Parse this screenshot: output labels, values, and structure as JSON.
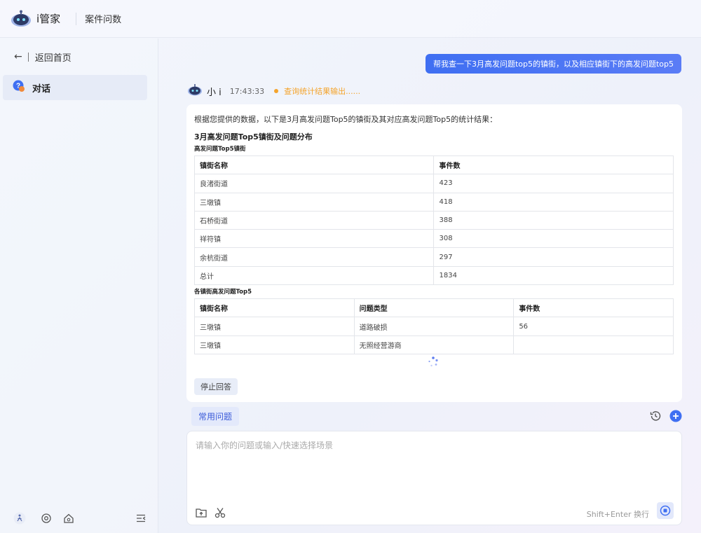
{
  "header": {
    "brand": "i管家",
    "title": "案件问数"
  },
  "sidebar": {
    "back_label": "返回首页",
    "items": [
      {
        "label": "对话",
        "active": true
      }
    ],
    "footer_icons": [
      "accessibility-icon",
      "settings-icon",
      "home-icon",
      "collapse-menu-icon"
    ]
  },
  "chat": {
    "user_message": "帮我查一下3月高发问题top5的镇街，以及相应镇街下的高发问题top5",
    "bot_name": "小 i",
    "bot_time": "17:43:33",
    "status_text": "查询统计结果输出......",
    "answer": {
      "intro": "根据您提供的数据，以下是3月高发问题Top5的镇街及其对应高发问题Top5的统计结果：",
      "section_title": "3月高发问题Top5镇街及问题分布",
      "table1": {
        "title": "高发问题Top5镇街",
        "headers": [
          "镇街名称",
          "事件数"
        ],
        "rows": [
          [
            "良渚街道",
            "423"
          ],
          [
            "三墩镇",
            "418"
          ],
          [
            "石桥街道",
            "388"
          ],
          [
            "祥符镇",
            "308"
          ],
          [
            "余杭街道",
            "297"
          ],
          [
            "总计",
            "1834"
          ]
        ]
      },
      "table2": {
        "title": "各镇街高发问题Top5",
        "headers": [
          "镇街名称",
          "问题类型",
          "事件数"
        ],
        "rows": [
          [
            "三墩镇",
            "道路破损",
            "56"
          ],
          [
            "三墩镇",
            "无照经营游商",
            ""
          ]
        ]
      },
      "stop_label": "停止回答"
    }
  },
  "composer": {
    "faq_label": "常用问题",
    "placeholder": "请输入你的问题或输入/快速选择场景",
    "hint": "Shift+Enter 换行"
  },
  "colors": {
    "accent": "#3f6ff2",
    "status": "#f4a42c"
  }
}
